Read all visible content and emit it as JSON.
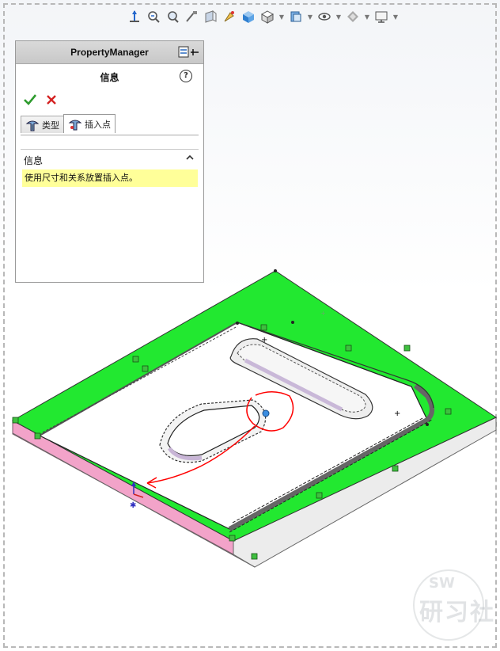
{
  "property_manager": {
    "header_title": "PropertyManager",
    "feature_title": "信息",
    "tabs": [
      {
        "label": "类型",
        "icon": "hole-type-icon"
      },
      {
        "label": "插入点",
        "icon": "hole-position-icon"
      }
    ],
    "group": {
      "label": "信息",
      "message": "使用尺寸和关系放置插入点。"
    }
  },
  "toolbar": {
    "icons": [
      "view-orientation-icon",
      "zoom-to-fit-icon",
      "zoom-area-icon",
      "previous-view-icon",
      "section-view-icon",
      "dynamic-annotation-icon",
      "view-orientation-cube-icon",
      "display-style-icon",
      "hide-show-items-icon",
      "edit-appearance-icon",
      "apply-scene-icon",
      "view-settings-icon"
    ]
  },
  "watermark": {
    "line1": "SW",
    "line2": "研习社"
  },
  "colors": {
    "face_green": "#22e830",
    "side_pink": "#f0a0c8",
    "annotation_red": "#ff0000",
    "info_yellow": "#ffff99"
  }
}
